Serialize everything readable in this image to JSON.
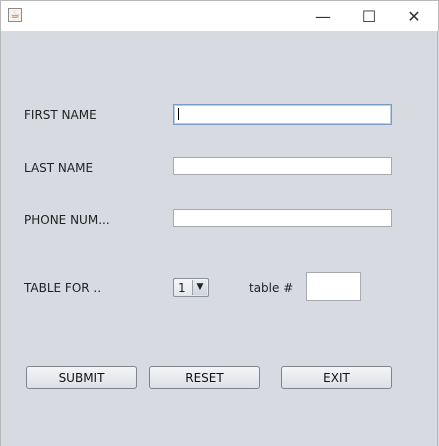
{
  "window": {
    "icon": "java-cup-icon",
    "controls": {
      "minimize": "—",
      "maximize": "☐",
      "close": "✕"
    }
  },
  "form": {
    "first_name_label": "FIRST NAME",
    "first_name_value": "",
    "last_name_label": "LAST NAME",
    "last_name_value": "",
    "phone_label": "PHONE NUM...",
    "phone_value": "",
    "table_for_label": "TABLE FOR ..",
    "table_for_selected": "1",
    "table_num_label": "table #",
    "table_num_value": ""
  },
  "buttons": {
    "submit": "SUBMIT",
    "reset": "RESET",
    "exit": "EXIT"
  }
}
